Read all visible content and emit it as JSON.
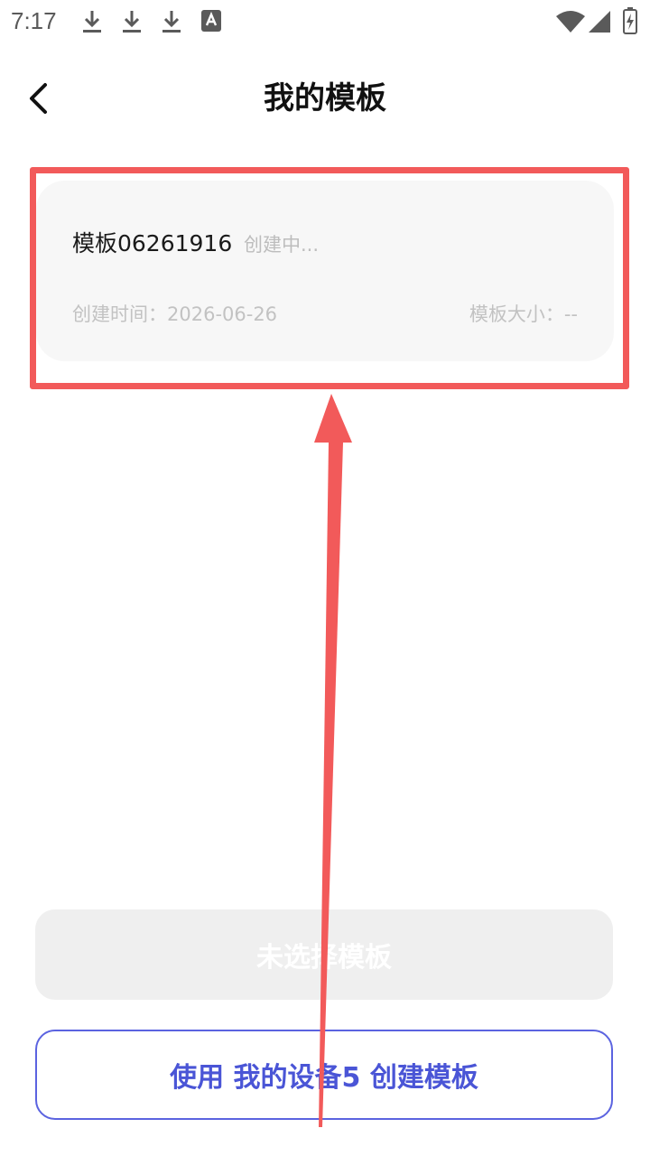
{
  "status_bar": {
    "time": "7:17",
    "icons": [
      "download-icon",
      "download-icon",
      "download-icon",
      "text-a-icon",
      "wifi-icon",
      "cellular-icon",
      "battery-charging-icon"
    ]
  },
  "header": {
    "title": "我的模板",
    "back_icon": "chevron-left-icon"
  },
  "templates": [
    {
      "name": "模板06261916",
      "status": "创建中...",
      "created_time": "创建时间：2026-06-26",
      "size": "模板大小：--"
    }
  ],
  "buttons": {
    "no_template_selected": "未选择模板",
    "create_template": "使用 我的设备5 创建模板"
  },
  "colors": {
    "annotation": "#f25a5a",
    "primary": "#4a55d6",
    "card_bg": "#f7f7f7",
    "disabled_bg": "#efefef"
  }
}
